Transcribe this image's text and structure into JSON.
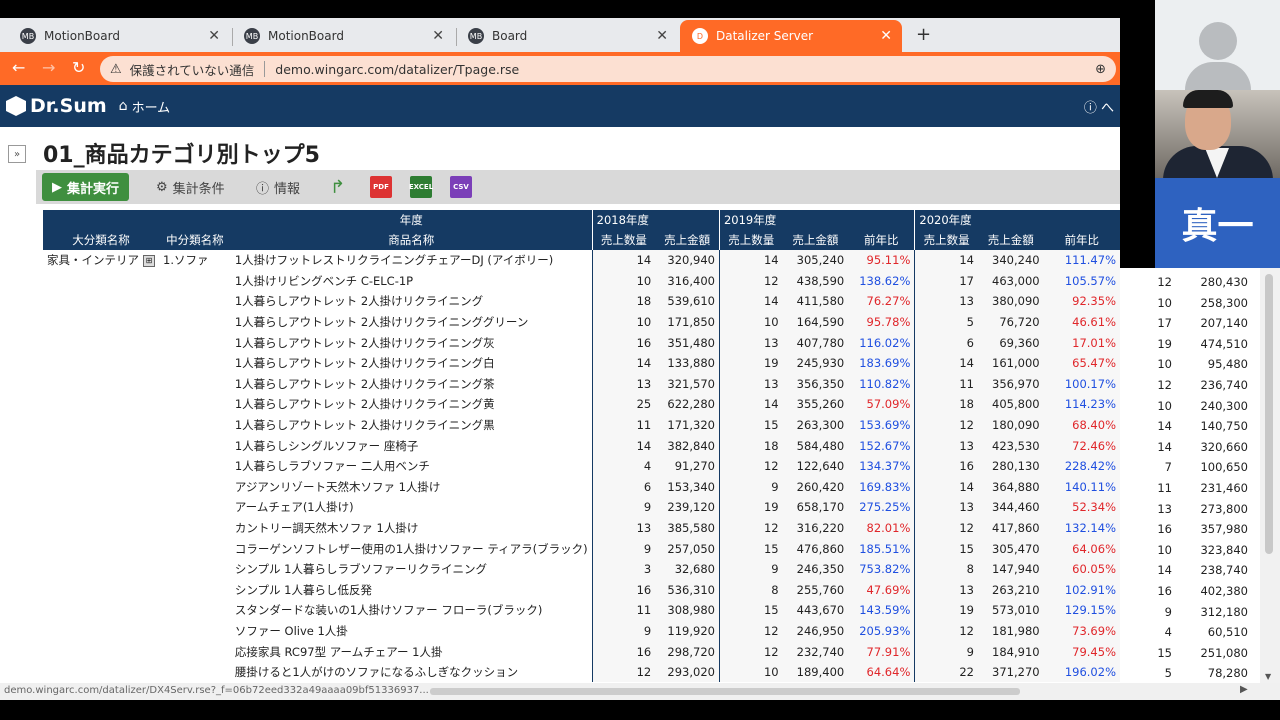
{
  "browser": {
    "tabs": [
      {
        "label": "MotionBoard",
        "favicon": "MB"
      },
      {
        "label": "MotionBoard",
        "favicon": "MB"
      },
      {
        "label": "Board",
        "favicon": "MB"
      },
      {
        "label": "Datalizer Server",
        "favicon": "D"
      }
    ],
    "new_tab": "+",
    "insecure_label": "保護されていない通信",
    "url": "demo.wingarc.com/datalizer/Tpage.rse"
  },
  "app": {
    "logo": "Dr.Sum",
    "home": "ホーム",
    "help": "へ"
  },
  "page": {
    "title": "01_商品カテゴリ別トップ5"
  },
  "toolbar": {
    "run": "集計実行",
    "conditions": "集計条件",
    "info": "情報",
    "pdf": "PDF",
    "excel": "EXCEL",
    "csv": "CSV"
  },
  "table": {
    "header_top": {
      "year_label": "年度",
      "y2018": "2018年度",
      "y2019": "2019年度",
      "y2020": "2020年度"
    },
    "header_bottom": {
      "major": "大分類名称",
      "middle": "中分類名称",
      "product": "商品名称",
      "qty": "売上数量",
      "amount": "売上金額",
      "yoy": "前年比"
    },
    "major_value": "家具・インテリア",
    "middle_value": "1.ソファ",
    "rows": [
      {
        "name": "1人掛けフットレストリクライニングチェアーDJ (アイボリー)",
        "q18": "14",
        "a18": "320,940",
        "q19": "14",
        "a19": "305,240",
        "r19": "95.11%",
        "q20": "14",
        "a20": "340,240",
        "r20": "111.47%",
        "qn": "",
        "an": ""
      },
      {
        "name": "1人掛けリビングベンチ C-ELC-1P",
        "q18": "10",
        "a18": "316,400",
        "q19": "12",
        "a19": "438,590",
        "r19": "138.62%",
        "q20": "17",
        "a20": "463,000",
        "r20": "105.57%",
        "qn": "12",
        "an": "280,430"
      },
      {
        "name": "1人暮らしアウトレット 2人掛けリクライニング",
        "q18": "18",
        "a18": "539,610",
        "q19": "14",
        "a19": "411,580",
        "r19": "76.27%",
        "q20": "13",
        "a20": "380,090",
        "r20": "92.35%",
        "qn": "10",
        "an": "258,300"
      },
      {
        "name": "1人暮らしアウトレット 2人掛けリクライニンググリーン",
        "q18": "10",
        "a18": "171,850",
        "q19": "10",
        "a19": "164,590",
        "r19": "95.78%",
        "q20": "5",
        "a20": "76,720",
        "r20": "46.61%",
        "qn": "17",
        "an": "207,140"
      },
      {
        "name": "1人暮らしアウトレット 2人掛けリクライニング灰",
        "q18": "16",
        "a18": "351,480",
        "q19": "13",
        "a19": "407,780",
        "r19": "116.02%",
        "q20": "6",
        "a20": "69,360",
        "r20": "17.01%",
        "qn": "19",
        "an": "474,510"
      },
      {
        "name": "1人暮らしアウトレット 2人掛けリクライニング白",
        "q18": "14",
        "a18": "133,880",
        "q19": "19",
        "a19": "245,930",
        "r19": "183.69%",
        "q20": "14",
        "a20": "161,000",
        "r20": "65.47%",
        "qn": "10",
        "an": "95,480"
      },
      {
        "name": "1人暮らしアウトレット 2人掛けリクライニング茶",
        "q18": "13",
        "a18": "321,570",
        "q19": "13",
        "a19": "356,350",
        "r19": "110.82%",
        "q20": "11",
        "a20": "356,970",
        "r20": "100.17%",
        "qn": "12",
        "an": "236,740"
      },
      {
        "name": "1人暮らしアウトレット 2人掛けリクライニング黄",
        "q18": "25",
        "a18": "622,280",
        "q19": "14",
        "a19": "355,260",
        "r19": "57.09%",
        "q20": "18",
        "a20": "405,800",
        "r20": "114.23%",
        "qn": "10",
        "an": "240,300"
      },
      {
        "name": "1人暮らしアウトレット 2人掛けリクライニング黒",
        "q18": "11",
        "a18": "171,320",
        "q19": "15",
        "a19": "263,300",
        "r19": "153.69%",
        "q20": "12",
        "a20": "180,090",
        "r20": "68.40%",
        "qn": "14",
        "an": "140,750"
      },
      {
        "name": "1人暮らしシングルソファー 座椅子",
        "q18": "14",
        "a18": "382,840",
        "q19": "18",
        "a19": "584,480",
        "r19": "152.67%",
        "q20": "13",
        "a20": "423,530",
        "r20": "72.46%",
        "qn": "14",
        "an": "320,660"
      },
      {
        "name": "1人暮らしラブソファー 二人用ベンチ",
        "q18": "4",
        "a18": "91,270",
        "q19": "12",
        "a19": "122,640",
        "r19": "134.37%",
        "q20": "16",
        "a20": "280,130",
        "r20": "228.42%",
        "qn": "7",
        "an": "100,650"
      },
      {
        "name": "アジアンリゾート天然木ソファ 1人掛け",
        "q18": "6",
        "a18": "153,340",
        "q19": "9",
        "a19": "260,420",
        "r19": "169.83%",
        "q20": "14",
        "a20": "364,880",
        "r20": "140.11%",
        "qn": "11",
        "an": "231,460"
      },
      {
        "name": "アームチェア(1人掛け)",
        "q18": "9",
        "a18": "239,120",
        "q19": "19",
        "a19": "658,170",
        "r19": "275.25%",
        "q20": "13",
        "a20": "344,460",
        "r20": "52.34%",
        "qn": "13",
        "an": "273,800"
      },
      {
        "name": "カントリー調天然木ソファ 1人掛け",
        "q18": "13",
        "a18": "385,580",
        "q19": "12",
        "a19": "316,220",
        "r19": "82.01%",
        "q20": "12",
        "a20": "417,860",
        "r20": "132.14%",
        "qn": "16",
        "an": "357,980"
      },
      {
        "name": "コラーゲンソフトレザー使用の1人掛けソファー ティアラ(ブラック)",
        "q18": "9",
        "a18": "257,050",
        "q19": "15",
        "a19": "476,860",
        "r19": "185.51%",
        "q20": "15",
        "a20": "305,470",
        "r20": "64.06%",
        "qn": "10",
        "an": "323,840"
      },
      {
        "name": "シンプル 1人暮らしラブソファーリクライニング",
        "q18": "3",
        "a18": "32,680",
        "q19": "9",
        "a19": "246,350",
        "r19": "753.82%",
        "q20": "8",
        "a20": "147,940",
        "r20": "60.05%",
        "qn": "14",
        "an": "238,740"
      },
      {
        "name": "シンプル 1人暮らし低反発",
        "q18": "16",
        "a18": "536,310",
        "q19": "8",
        "a19": "255,760",
        "r19": "47.69%",
        "q20": "13",
        "a20": "263,210",
        "r20": "102.91%",
        "qn": "16",
        "an": "402,380"
      },
      {
        "name": "スタンダードな装いの1人掛けソファー フローラ(ブラック)",
        "q18": "11",
        "a18": "308,980",
        "q19": "15",
        "a19": "443,670",
        "r19": "143.59%",
        "q20": "19",
        "a20": "573,010",
        "r20": "129.15%",
        "qn": "9",
        "an": "312,180"
      },
      {
        "name": "ソファー Olive 1人掛",
        "q18": "9",
        "a18": "119,920",
        "q19": "12",
        "a19": "246,950",
        "r19": "205.93%",
        "q20": "12",
        "a20": "181,980",
        "r20": "73.69%",
        "qn": "4",
        "an": "60,510"
      },
      {
        "name": "応接家具 RC97型 アームチェアー 1人掛",
        "q18": "16",
        "a18": "298,720",
        "q19": "12",
        "a19": "232,740",
        "r19": "77.91%",
        "q20": "9",
        "a20": "184,910",
        "r20": "79.45%",
        "qn": "15",
        "an": "251,080"
      },
      {
        "name": "腰掛けると1人がけのソファになるふしぎなクッション",
        "q18": "12",
        "a18": "293,020",
        "q19": "10",
        "a19": "189,400",
        "r19": "64.64%",
        "q20": "22",
        "a20": "371,270",
        "r20": "196.02%",
        "qn": "5",
        "an": "78,280"
      }
    ]
  },
  "video": {
    "participant_name": "真一"
  },
  "statusbar": {
    "link": "demo.wingarc.com/datalizer/DX4Serv.rse?_f=06b72eed332a49aaaa09bf51336937..."
  },
  "colors": {
    "accent_orange": "#ff6a26",
    "header_navy": "#153a63",
    "run_green": "#3f8f3f",
    "yoy_up": "#1f4fe0",
    "yoy_down": "#e0262a"
  }
}
